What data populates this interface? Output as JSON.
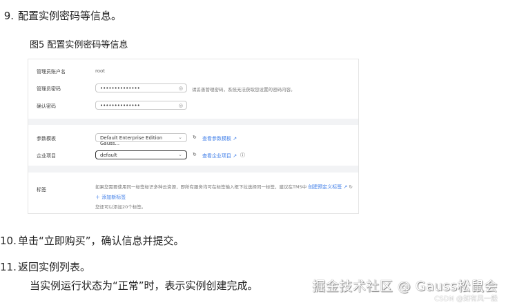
{
  "steps": {
    "s9": {
      "num": "9.",
      "text": "配置实例密码等信息。"
    },
    "figure_caption": "图5 配置实例密码等信息",
    "s10": {
      "num": "10.",
      "text": "单击“立即购买”，确认信息并提交。"
    },
    "s11": {
      "num": "11.",
      "text": "返回实例列表。",
      "sub": "当实例运行状态为“正常”时，表示实例创建完成。"
    }
  },
  "form": {
    "admin_user_label": "管理员账户名",
    "admin_user_value": "root",
    "admin_pwd_label": "管理员密码",
    "admin_pwd_value": "••••••••••••••",
    "admin_pwd_hint": "请妥善管理密码，系统无法获取您设置的密码内容。",
    "confirm_pwd_label": "确认密码",
    "confirm_pwd_value": "••••••••••••••",
    "param_label": "参数模板",
    "param_value": "Default Enterprise Edition Gauss...",
    "param_link": "查看参数模板",
    "enterprise_label": "企业项目",
    "enterprise_value": "default",
    "enterprise_link": "查看企业项目",
    "tag_label": "标签",
    "tag_desc": "如果您需要使用同一标签标识多种云资源，即所有服务均可在标签输入框下拉选择同一标签，建议在TMS中",
    "tag_link": "创建预定义标签",
    "add_tag": "添加新标签",
    "tag_limit": "您还可以添加20个标签。"
  },
  "watermark": {
    "main": "掘金技术社区 @ Gauss松鼠会",
    "sub": "CSDN @如有风一般"
  }
}
